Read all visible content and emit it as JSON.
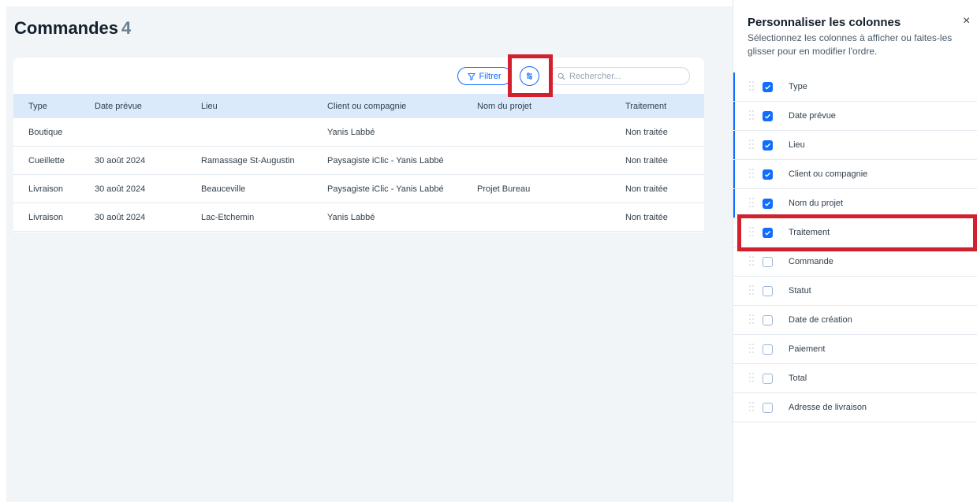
{
  "main": {
    "title": "Commandes",
    "count": "4",
    "toolbar": {
      "filter_label": "Filtrer",
      "search_placeholder": "Rechercher..."
    },
    "table": {
      "headers": [
        "Type",
        "Date prévue",
        "Lieu",
        "Client ou compagnie",
        "Nom du projet",
        "Traitement"
      ],
      "rows": [
        [
          "Boutique",
          "",
          "",
          "Yanis Labbé",
          "",
          "Non traitée"
        ],
        [
          "Cueillette",
          "30 août 2024",
          "Ramassage St-Augustin",
          "Paysagiste iClic - Yanis Labbé",
          "",
          "Non traitée"
        ],
        [
          "Livraison",
          "30 août 2024",
          "Beauceville",
          "Paysagiste iClic - Yanis Labbé",
          "Projet Bureau",
          "Non traitée"
        ],
        [
          "Livraison",
          "30 août 2024",
          "Lac-Etchemin",
          "Yanis Labbé",
          "",
          "Non traitée"
        ]
      ]
    }
  },
  "panel": {
    "title": "Personnaliser les colonnes",
    "subtitle": "Sélectionnez les colonnes à afficher ou faites-les glisser pour en modifier l'ordre.",
    "close_glyph": "×",
    "columns": [
      {
        "label": "Type",
        "checked": true
      },
      {
        "label": "Date prévue",
        "checked": true
      },
      {
        "label": "Lieu",
        "checked": true
      },
      {
        "label": "Client ou compagnie",
        "checked": true
      },
      {
        "label": "Nom du projet",
        "checked": true
      },
      {
        "label": "Traitement",
        "checked": true
      },
      {
        "label": "Commande",
        "checked": false
      },
      {
        "label": "Statut",
        "checked": false
      },
      {
        "label": "Date de création",
        "checked": false
      },
      {
        "label": "Paiement",
        "checked": false
      },
      {
        "label": "Total",
        "checked": false
      },
      {
        "label": "Adresse de livraison",
        "checked": false
      }
    ]
  },
  "colors": {
    "accent": "#116dff",
    "highlight": "#d2202f",
    "header_bg": "#daeafb",
    "page_bg": "#f1f5f8"
  },
  "icons": {
    "filter": "filter-icon",
    "columns": "columns-settings-icon",
    "search": "search-icon",
    "close": "close-icon",
    "drag": "drag-handle-icon",
    "check": "check-icon"
  }
}
